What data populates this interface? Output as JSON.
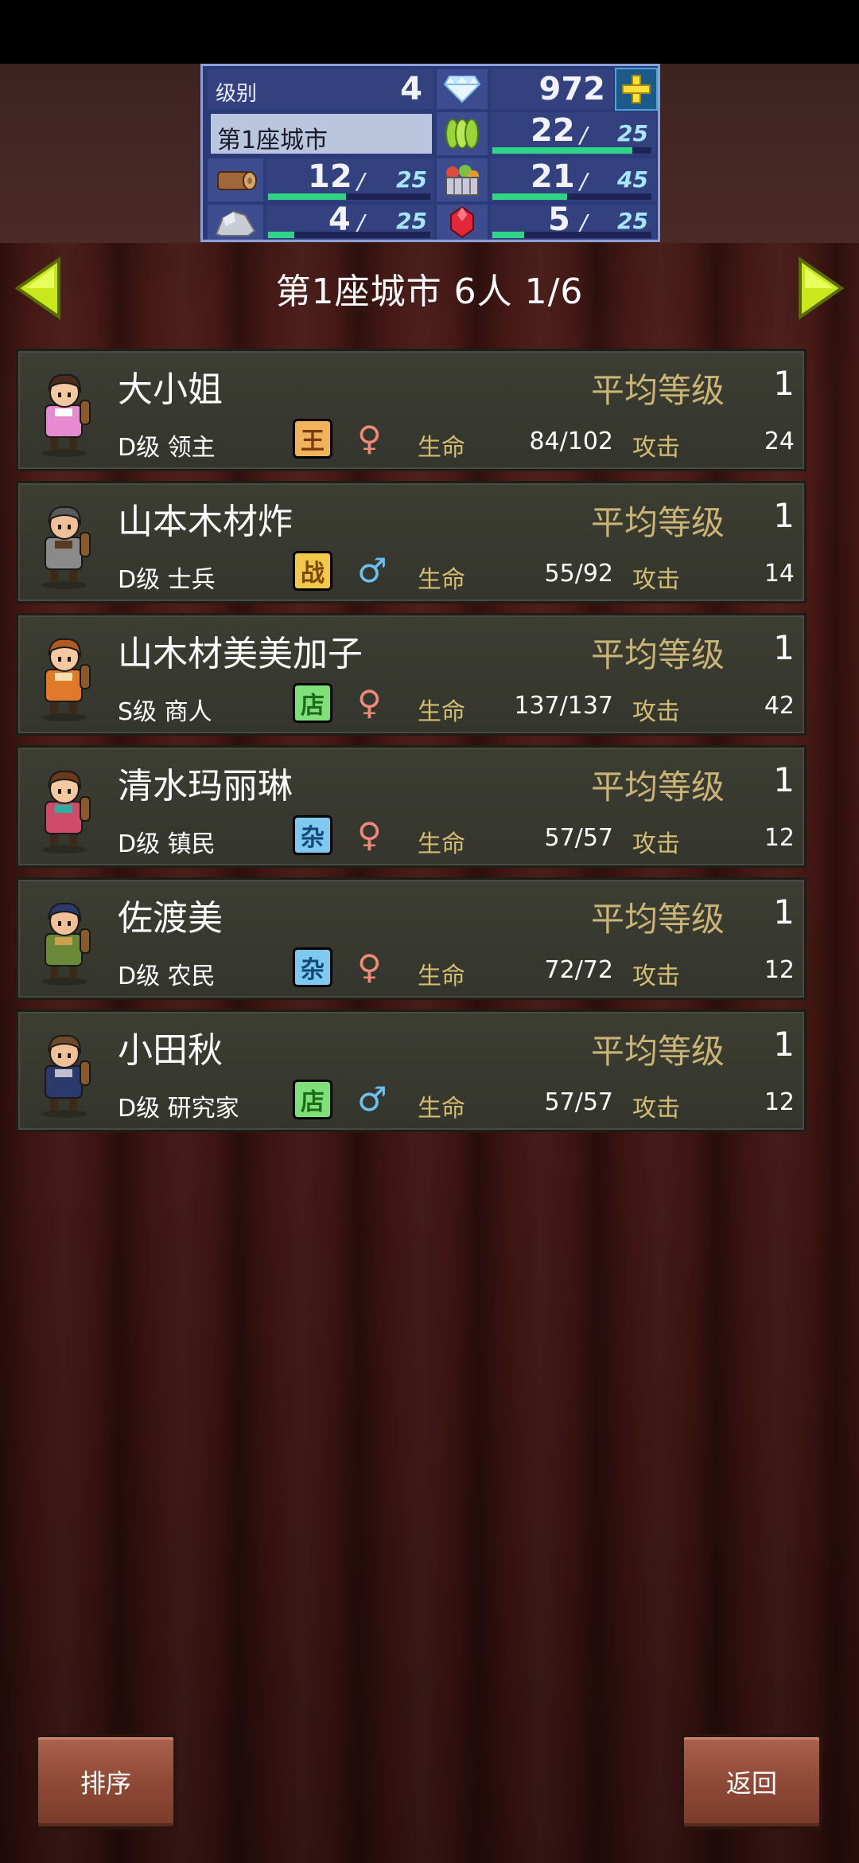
{
  "status": {
    "level_label": "级别",
    "level_value": "4",
    "gems": "972",
    "city_name": "第1座城市",
    "resources": {
      "grass": {
        "current": "22",
        "max": "25",
        "fill": 0.88
      },
      "wood": {
        "current": "12",
        "max": "25",
        "fill": 0.48
      },
      "food": {
        "current": "21",
        "max": "45",
        "fill": 0.47
      },
      "stone": {
        "current": "4",
        "max": "25",
        "fill": 0.16
      },
      "ruby": {
        "current": "5",
        "max": "25",
        "fill": 0.2
      }
    },
    "slash": "/"
  },
  "header": {
    "title": "第1座城市  6人  1/6"
  },
  "labels": {
    "avg_level": "平均等级",
    "hp": "生命",
    "atk": "攻击"
  },
  "residents": [
    {
      "name": "大小姐",
      "avg_level": "1",
      "rank": "D级 领主",
      "badge": "王",
      "badge_color": "#f0b25a",
      "badge_text_color": "#7a3b0b",
      "gender": "♀",
      "gender_color": "#f08a78",
      "hp": "84/102",
      "atk": "24",
      "avatar": "princess"
    },
    {
      "name": "山本木材炸",
      "avg_level": "1",
      "rank": "D级 士兵",
      "badge": "战",
      "badge_color": "#f2c84a",
      "badge_text_color": "#7a4a00",
      "gender": "♂",
      "gender_color": "#6cc0f0",
      "hp": "55/92",
      "atk": "14",
      "avatar": "soldier"
    },
    {
      "name": "山木材美美加子",
      "avg_level": "1",
      "rank": "S级 商人",
      "badge": "店",
      "badge_color": "#7fe07a",
      "badge_text_color": "#1c6a1a",
      "gender": "♀",
      "gender_color": "#f08a78",
      "hp": "137/137",
      "atk": "42",
      "avatar": "merchant"
    },
    {
      "name": "清水玛丽琳",
      "avg_level": "1",
      "rank": "D级 镇民",
      "badge": "杂",
      "badge_color": "#7fc8f0",
      "badge_text_color": "#134a78",
      "gender": "♀",
      "gender_color": "#f08a78",
      "hp": "57/57",
      "atk": "12",
      "avatar": "villager"
    },
    {
      "name": "佐渡美",
      "avg_level": "1",
      "rank": "D级 农民",
      "badge": "杂",
      "badge_color": "#7fc8f0",
      "badge_text_color": "#134a78",
      "gender": "♀",
      "gender_color": "#f08a78",
      "hp": "72/72",
      "atk": "12",
      "avatar": "farmer"
    },
    {
      "name": "小田秋",
      "avg_level": "1",
      "rank": "D级 研究家",
      "badge": "店",
      "badge_color": "#7fe07a",
      "badge_text_color": "#1c6a1a",
      "gender": "♂",
      "gender_color": "#6cc0f0",
      "hp": "57/57",
      "atk": "12",
      "avatar": "researcher"
    }
  ],
  "buttons": {
    "sort": "排序",
    "back": "返回"
  }
}
